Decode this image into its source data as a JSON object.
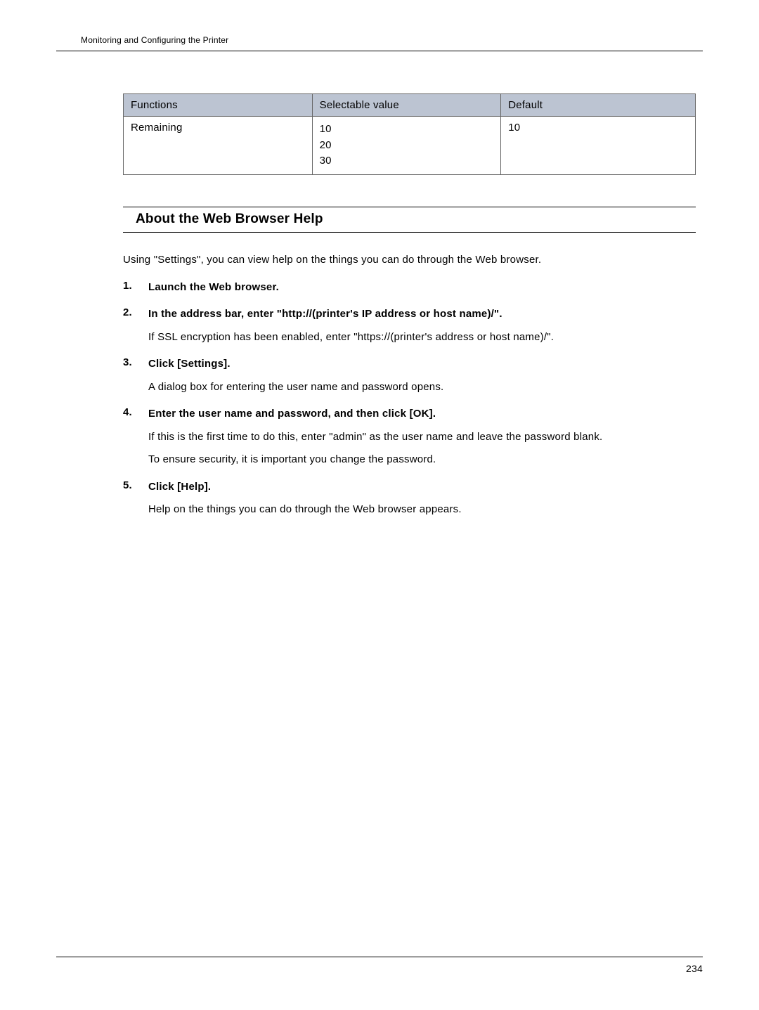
{
  "header": {
    "chapter_title": "Monitoring and Configuring the Printer"
  },
  "table": {
    "headers": {
      "functions": "Functions",
      "selectable_value": "Selectable value",
      "default": "Default"
    },
    "rows": [
      {
        "function": "Remaining",
        "values": [
          "10",
          "20",
          "30"
        ],
        "default": "10"
      }
    ]
  },
  "section": {
    "heading": "About the Web Browser Help",
    "intro": "Using \"Settings\", you can view help on the things you can do through the Web browser.",
    "steps": [
      {
        "title": "Launch the Web browser.",
        "body": []
      },
      {
        "title": "In the address bar, enter \"http://(printer's IP address or host name)/\".",
        "body": [
          "If SSL encryption has been enabled, enter \"https://(printer's address or host name)/\"."
        ]
      },
      {
        "title": "Click [Settings].",
        "body": [
          "A dialog box for entering the user name and password opens."
        ]
      },
      {
        "title": "Enter the user name and password, and then click [OK].",
        "body": [
          "If this is the first time to do this, enter \"admin\" as the user name and leave the password blank.",
          "To ensure security, it is important you change the password."
        ]
      },
      {
        "title": "Click [Help].",
        "body": [
          "Help on the things you can do through the Web browser appears."
        ]
      }
    ]
  },
  "footer": {
    "page_number": "234"
  }
}
